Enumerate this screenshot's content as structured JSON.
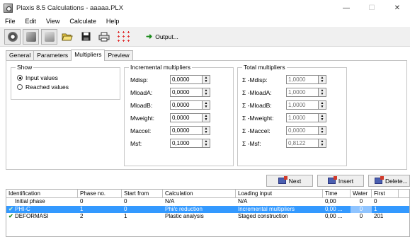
{
  "window": {
    "title": "Plaxis 8.5 Calculations - aaaaa.PLX",
    "minimize": "—",
    "maximize": "☐",
    "close": "✕"
  },
  "menu": [
    "File",
    "Edit",
    "View",
    "Calculate",
    "Help"
  ],
  "toolbar": {
    "output_label": "Output..."
  },
  "tabs": [
    {
      "label": "General",
      "active": false
    },
    {
      "label": "Parameters",
      "active": false
    },
    {
      "label": "Multipliers",
      "active": true
    },
    {
      "label": "Preview",
      "active": false
    }
  ],
  "show_group": {
    "title": "Show",
    "options": [
      {
        "label": "Input values",
        "selected": true
      },
      {
        "label": "Reached values",
        "selected": false
      }
    ]
  },
  "incremental": {
    "title": "Incremental multipliers",
    "fields": [
      {
        "label": "Mdisp:",
        "value": "0,0000"
      },
      {
        "label": "MloadA:",
        "value": "0,0000"
      },
      {
        "label": "MloadB:",
        "value": "0,0000"
      },
      {
        "label": "Mweight:",
        "value": "0,0000"
      },
      {
        "label": "Maccel:",
        "value": "0,0000"
      },
      {
        "label": "Msf:",
        "value": "0,1000"
      }
    ]
  },
  "total": {
    "title": "Total multipliers",
    "fields": [
      {
        "label": "Σ -Mdisp:",
        "value": "1,0000"
      },
      {
        "label": "Σ -MloadA:",
        "value": "1,0000"
      },
      {
        "label": "Σ -MloadB:",
        "value": "1,0000"
      },
      {
        "label": "Σ -Mweight:",
        "value": "1,0000"
      },
      {
        "label": "Σ -Maccel:",
        "value": "0,0000"
      },
      {
        "label": "Σ -Msf:",
        "value": "0,8122"
      }
    ]
  },
  "actions": {
    "next": "Next",
    "insert": "Insert",
    "delete": "Delete..."
  },
  "phases": {
    "columns": [
      "Identification",
      "Phase no.",
      "Start from",
      "Calculation",
      "Loading input",
      "Time",
      "Water",
      "First"
    ],
    "rows": [
      {
        "identification": "Initial phase",
        "phase_no": "0",
        "start_from": "0",
        "calculation": "N/A",
        "loading": "N/A",
        "time": "0,00",
        "water": "0",
        "first": "0",
        "status": "",
        "selected": false
      },
      {
        "identification": "PHI-C",
        "phase_no": "1",
        "start_from": "0",
        "calculation": "Phi/c reduction",
        "loading": "Incremental multipliers",
        "time": "0,00 ...",
        "water": "0",
        "first": "1",
        "status": "✔",
        "selected": true
      },
      {
        "identification": "DEFORMASI",
        "phase_no": "2",
        "start_from": "1",
        "calculation": "Plastic analysis",
        "loading": "Staged construction",
        "time": "0,00 ...",
        "water": "0",
        "first": "201",
        "status": "✔",
        "selected": false
      }
    ]
  },
  "colors": {
    "selection": "#3399ff",
    "check": "#1f8a1f"
  }
}
